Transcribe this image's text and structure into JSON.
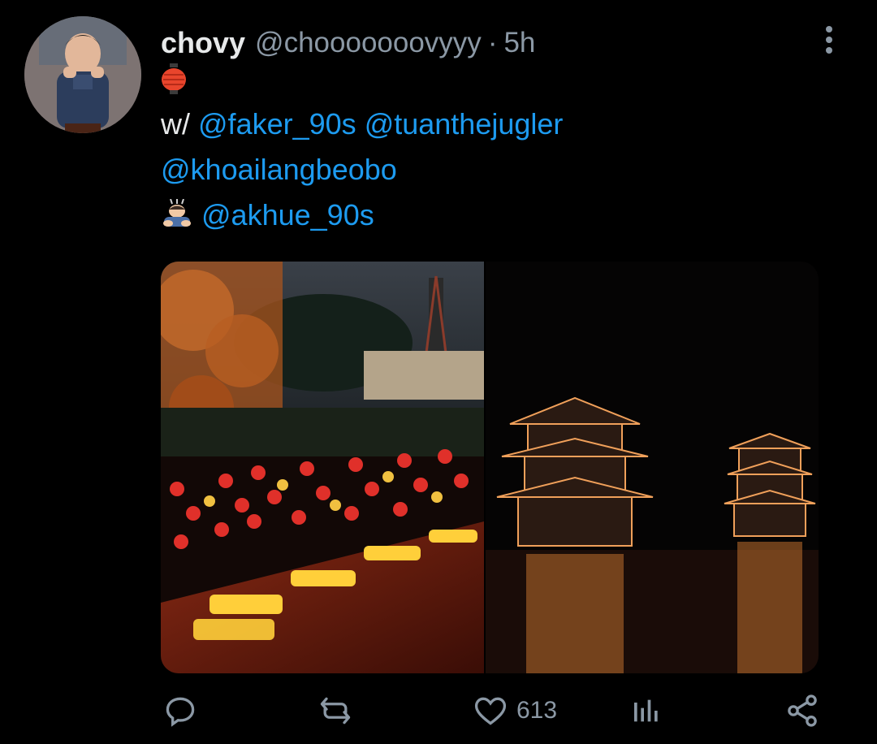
{
  "tweet": {
    "display_name": "chovy",
    "handle": "@chooooooovyyy",
    "separator": "·",
    "time": "5h",
    "emoji_line": "🏮",
    "line1_prefix": "w/",
    "mentions_line1": [
      "@faker_90s",
      "@tuanthejugler"
    ],
    "mention_line2": "@khoailangbeobo",
    "emoji_line3": "🙇🏻",
    "mention_line3": "@akhue_90s"
  },
  "media": {
    "left_image": "lantern-boats-night",
    "right_image": "pagodas-over-lake-night"
  },
  "actions": {
    "reply_icon": "reply-icon",
    "retweet_icon": "retweet-icon",
    "like_icon": "heart-icon",
    "like_count": "613",
    "views_icon": "analytics-icon",
    "share_icon": "share-icon"
  },
  "colors": {
    "background": "#000000",
    "text": "#e7e9ea",
    "secondary": "#8b98a5",
    "link": "#1d9bf0"
  }
}
